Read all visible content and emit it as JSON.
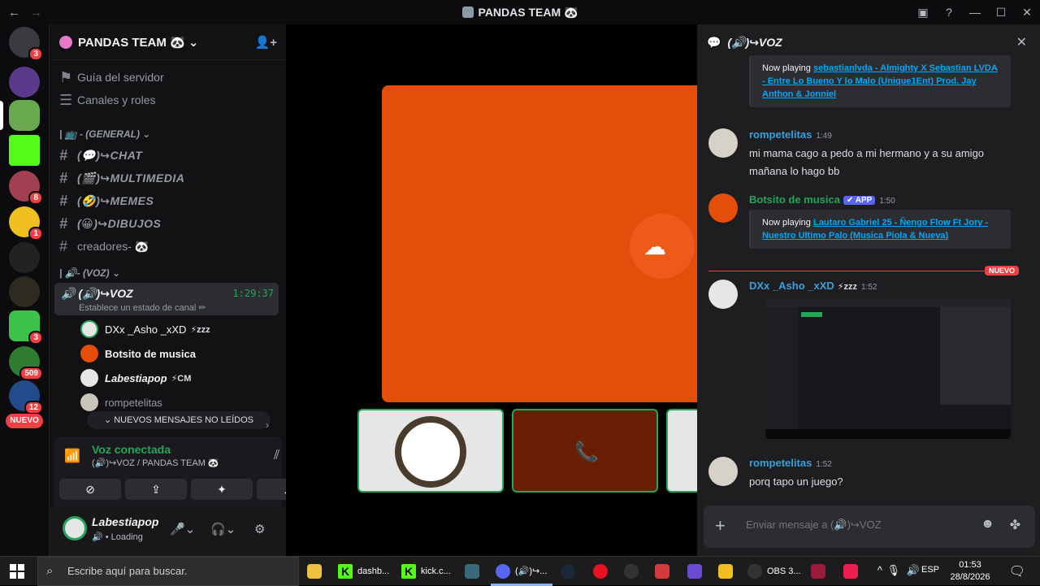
{
  "window": {
    "title": "PANDAS TEAM 🐼"
  },
  "guilds": {
    "badges": [
      "3",
      "8",
      "1",
      "3",
      "509",
      "12"
    ],
    "nuevo": "NUEVO"
  },
  "server": {
    "name": "PANDAS TEAM 🐼 ⌄"
  },
  "nav": {
    "guide": "Guía del servidor",
    "roles": "Canales y roles"
  },
  "categories": {
    "general": "| 📺 - (GENERAL) ⌄",
    "voz": "| 🔊- (VOZ) ⌄"
  },
  "text_channels": [
    "(💬)↪CHAT",
    "(🎬)↪MULTIMEDIA",
    "(🤣)↪MEMES",
    "(😀)↪DIBUJOS",
    "creadores- 🐼"
  ],
  "voice_channel": {
    "name": "(🔊)↪VOZ",
    "status": "Establece un estado de canal ✏",
    "time": "1:29:37"
  },
  "voice_users": [
    {
      "name": "DXx _Asho _xXD",
      "tag": "⚡zzz"
    },
    {
      "name": "Botsito de musica",
      "tag": ""
    },
    {
      "name": "Labestiapop",
      "tag": "⚡CM"
    },
    {
      "name": "rompetelitas",
      "tag": ""
    }
  ],
  "new_messages_pill": "⌄ NUEVOS MENSAJES NO LEÍDOS",
  "voice_panel": {
    "status": "Voz conectada",
    "location": "(🔊)↪VOZ / PANDAS TEAM 🐼"
  },
  "user": {
    "name": "Labestiapop",
    "status": "Loading"
  },
  "chat": {
    "title": "(🔊)↪VOZ",
    "embed1": {
      "lead": "Now playing ",
      "link": "sebastianlvda - Almighty X Sebastian LVDA - Entre Lo Bueno Y lo Malo (Unique1Ent) Prod. Jay Anthon & Jonniel"
    },
    "msg1": {
      "user": "rompetelitas",
      "time": "1:49",
      "line1": "mi mama cago a pedo a mi hermano y a su amigo",
      "line2": "mañana lo hago bb"
    },
    "msg2": {
      "user": "Botsito de musica",
      "badge": "✔ APP",
      "time": "1:50"
    },
    "embed2": {
      "lead": "Now playing ",
      "link": "Lautaro Gabriel 25 - Ñengo Flow Ft Jory - Nuestro Ultimo Palo (Musica Piola & Nueva)"
    },
    "divider_label": "NUEVO",
    "msg3": {
      "user": "DXx _Asho _xXD",
      "tag": "⚡zzz",
      "time": "1:52"
    },
    "msg4": {
      "user": "rompetelitas",
      "time": "1:52",
      "line1": "porq tapo un juego?"
    },
    "compose_placeholder": "Enviar mensaje a (🔊)↪VOZ"
  },
  "taskbar": {
    "search": "Escribe aquí para buscar.",
    "apps": [
      "dashb...",
      "kick.c...",
      "(🔊)↪...",
      "OBS 3..."
    ],
    "lang": "ESP",
    "time": "01:53",
    "date": "28/8/2026"
  },
  "colors": {
    "accent_green": "#23a55a",
    "link_blue": "#00a8fc",
    "soundcloud_orange": "#e44d0a",
    "alert_red": "#f23f43",
    "app_badge": "#5865f2"
  }
}
